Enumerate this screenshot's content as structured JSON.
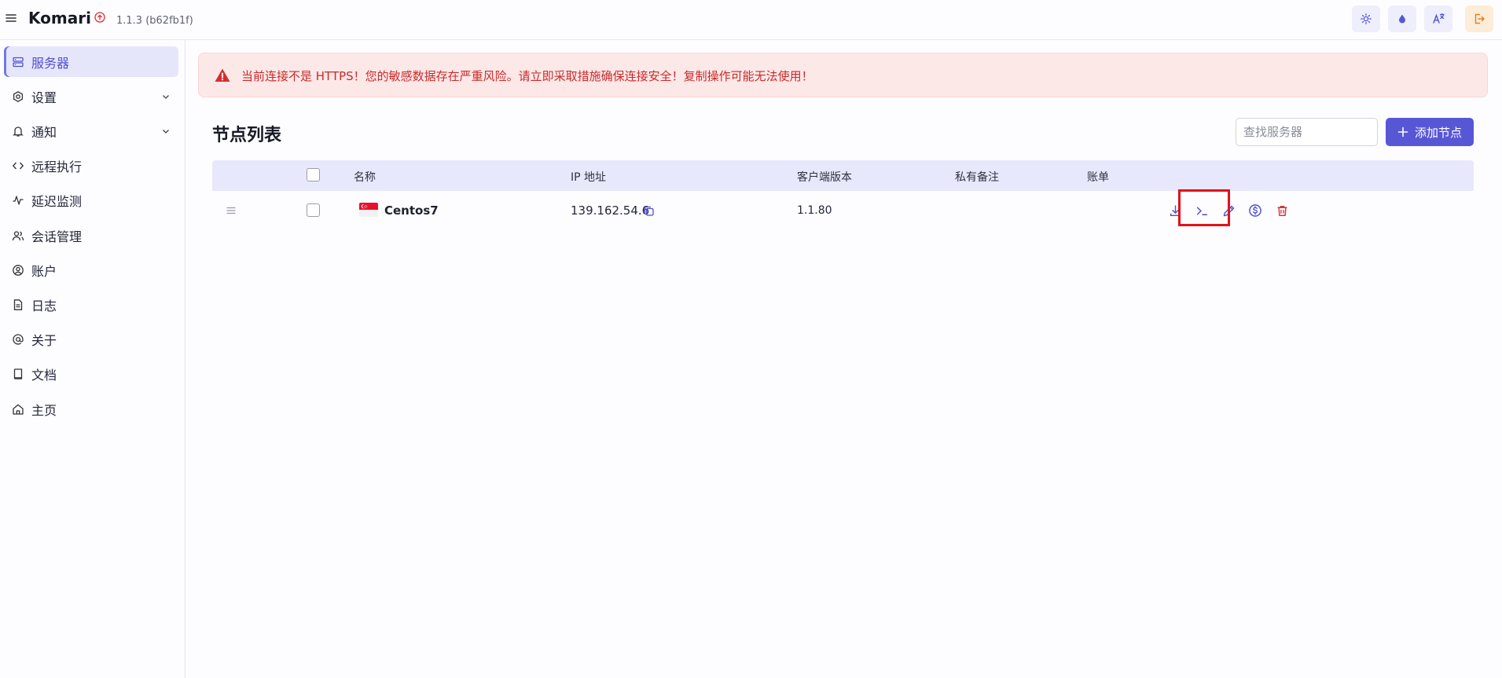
{
  "header": {
    "brand": "Komari",
    "version": "1.1.3 (b62fb1f)"
  },
  "sidebar": {
    "items": [
      {
        "label": "服务器",
        "icon": "server-icon",
        "active": true
      },
      {
        "label": "设置",
        "icon": "settings-icon",
        "expandable": true
      },
      {
        "label": "通知",
        "icon": "bell-icon",
        "expandable": true
      },
      {
        "label": "远程执行",
        "icon": "code-icon"
      },
      {
        "label": "延迟监测",
        "icon": "activity-icon"
      },
      {
        "label": "会话管理",
        "icon": "users-icon"
      },
      {
        "label": "账户",
        "icon": "account-icon"
      },
      {
        "label": "日志",
        "icon": "file-icon"
      },
      {
        "label": "关于",
        "icon": "at-icon"
      },
      {
        "label": "文档",
        "icon": "book-icon"
      },
      {
        "label": "主页",
        "icon": "home-icon"
      }
    ]
  },
  "alert": {
    "message": "当前连接不是 HTTPS！您的敏感数据存在严重风险。请立即采取措施确保连接安全！复制操作可能无法使用！"
  },
  "main": {
    "title": "节点列表",
    "search_placeholder": "查找服务器",
    "add_label": "添加节点"
  },
  "table": {
    "headers": {
      "name": "名称",
      "ip": "IP 地址",
      "client_version": "客户端版本",
      "private_note": "私有备注",
      "billing": "账单"
    },
    "rows": [
      {
        "flag": "SG",
        "name": "Centos7",
        "ip": "139.162.54.6",
        "version": "1.1.80",
        "note": "",
        "billing": ""
      }
    ]
  },
  "colors": {
    "accent": "#5757d6",
    "danger": "#d32f2f",
    "highlight": "#e0121b"
  }
}
